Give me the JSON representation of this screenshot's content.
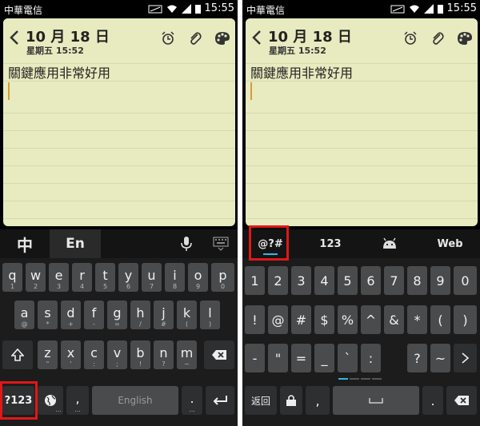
{
  "status": {
    "carrier": "中華電信",
    "time": "15:55"
  },
  "note": {
    "date": "10 月 18 日",
    "subtitle": "星期五 15:52",
    "body": "關鍵應用非常好用",
    "icons": [
      "chevron-left-icon",
      "alarm-icon",
      "paperclip-icon",
      "palette-icon"
    ]
  },
  "left_keyboard": {
    "topbar": {
      "lang_zh": "中",
      "lang_en": "En"
    },
    "row1": [
      "q",
      "w",
      "e",
      "r",
      "t",
      "y",
      "u",
      "i",
      "o",
      "p"
    ],
    "row1_hints": [
      "1",
      "2",
      "3",
      "4",
      "5",
      "6",
      "7",
      "8",
      "9",
      "0"
    ],
    "row2": [
      "a",
      "s",
      "d",
      "f",
      "g",
      "h",
      "j",
      "k",
      "l"
    ],
    "row2_hints": [
      "@",
      "*",
      "+",
      "-",
      "=",
      "/",
      "#",
      "(",
      ")"
    ],
    "row3": [
      "z",
      "x",
      "c",
      "v",
      "b",
      "n",
      "m"
    ],
    "row3_hints": [
      "\"",
      "'",
      ":",
      ";",
      "!",
      "?",
      "~"
    ],
    "symbols_key": "?123",
    "comma": ",",
    "comma_hint": "...",
    "space": "English",
    "period": ".",
    "period_hint": "..."
  },
  "right_keyboard": {
    "tabs": [
      "@?#",
      "123",
      "",
      "Web"
    ],
    "row1": [
      "1",
      "2",
      "3",
      "4",
      "5",
      "6",
      "7",
      "8",
      "9",
      "0"
    ],
    "row2": [
      "!",
      "@",
      "#",
      "$",
      "%",
      "^",
      "&",
      "*",
      "(",
      ")"
    ],
    "row3": [
      "-",
      "\"",
      "=",
      "_",
      "`",
      ":",
      "?",
      "~"
    ],
    "back_label": "返回",
    "comma": ",",
    "period": "."
  },
  "colors": {
    "highlight": "#e01818",
    "accent": "#33b5e5",
    "note_paper": "#e8ebbf"
  }
}
